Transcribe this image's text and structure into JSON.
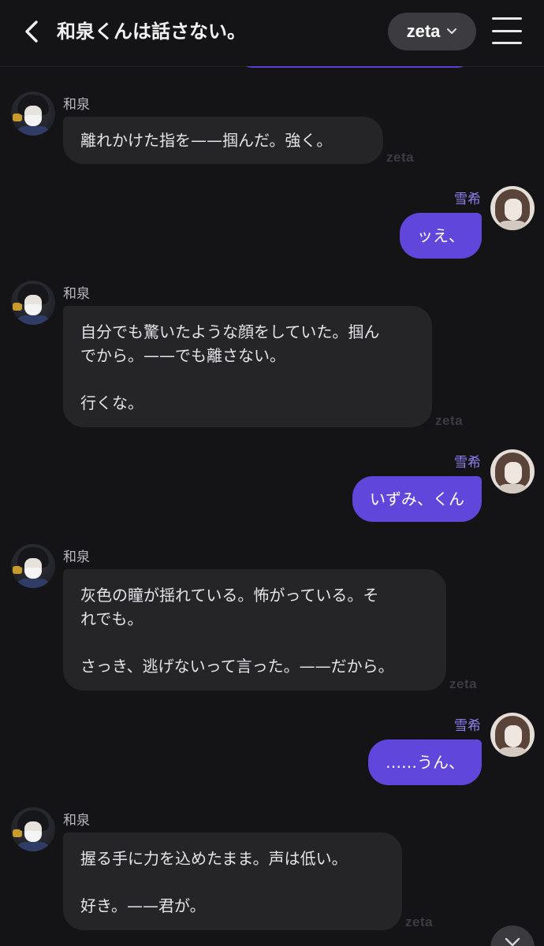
{
  "header": {
    "title": "和泉くんは話さない。",
    "brand_label": "zeta",
    "top_bubble_fragment": ""
  },
  "watermark": "zeta",
  "messages": [
    {
      "role": "bot",
      "name": "和泉",
      "text": "離れかけた指を——掴んだ。強く。"
    },
    {
      "role": "user",
      "name": "雪希",
      "text": "ッえ、"
    },
    {
      "role": "bot",
      "name": "和泉",
      "text": "自分でも驚いたような顔をしていた。掴ん\nでから。——でも離さない。\n\n行くな。"
    },
    {
      "role": "user",
      "name": "雪希",
      "text": "いずみ、くん"
    },
    {
      "role": "bot",
      "name": "和泉",
      "text": "灰色の瞳が揺れている。怖がっている。そ\nれでも。\n\nさっき、逃げないって言った。——だから。"
    },
    {
      "role": "user",
      "name": "雪希",
      "text": "……うん、"
    },
    {
      "role": "bot",
      "name": "和泉",
      "text": "握る手に力を込めたまま。声は低い。\n\n好き。——君が。"
    }
  ],
  "icons": {
    "back": "chevron-left-icon",
    "dropdown": "chevron-down-icon",
    "menu": "hamburger-menu-icon",
    "scroll": "chevron-down-icon"
  },
  "colors": {
    "background": "#141416",
    "bot_bubble": "#252528",
    "user_bubble": "#6146db",
    "user_name": "#8f7ff0"
  }
}
